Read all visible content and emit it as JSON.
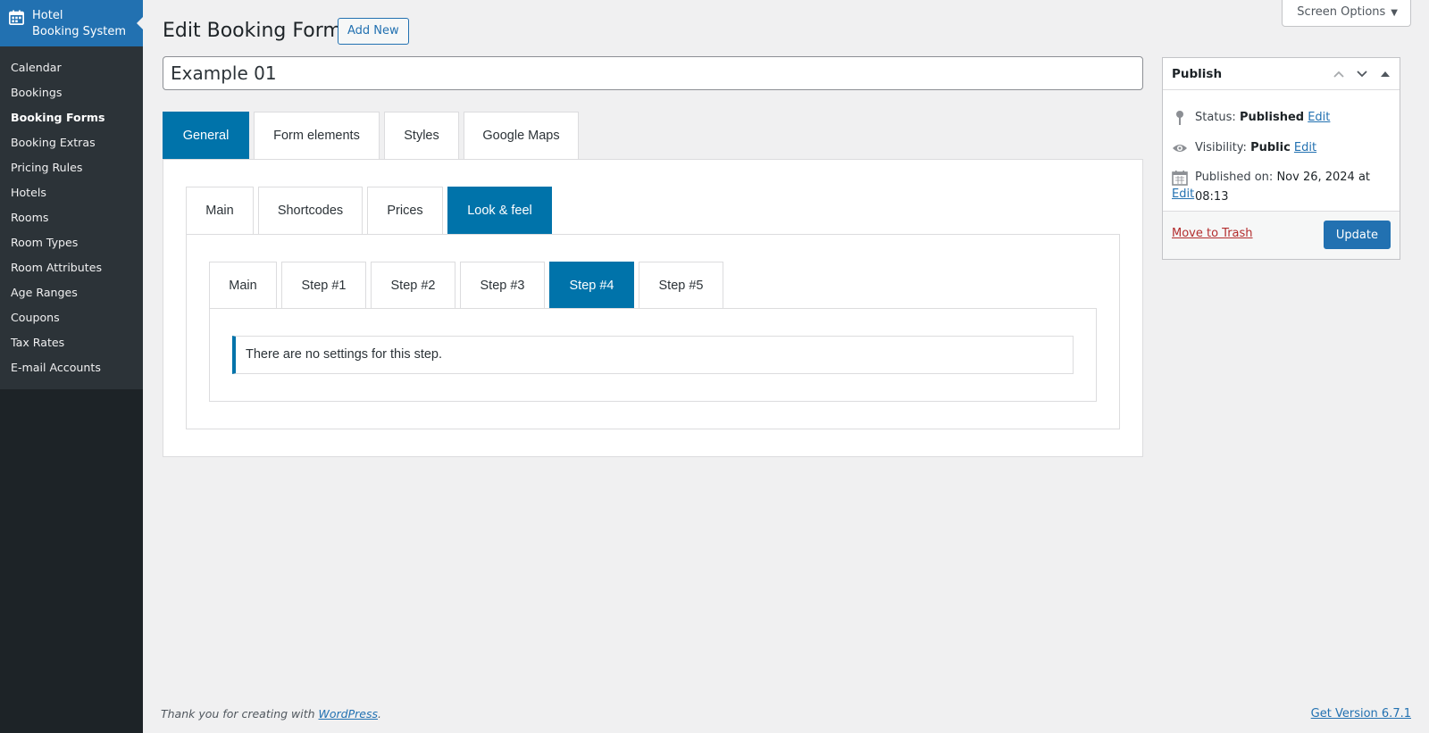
{
  "sidebar": {
    "brand_line1": "Hotel",
    "brand_line2": "Booking System",
    "brand_icon": "calendar-icon",
    "items": [
      {
        "label": "Calendar"
      },
      {
        "label": "Bookings"
      },
      {
        "label": "Booking Forms",
        "current": true
      },
      {
        "label": "Booking Extras"
      },
      {
        "label": "Pricing Rules"
      },
      {
        "label": "Hotels"
      },
      {
        "label": "Rooms"
      },
      {
        "label": "Room Types"
      },
      {
        "label": "Room Attributes"
      },
      {
        "label": "Age Ranges"
      },
      {
        "label": "Coupons"
      },
      {
        "label": "Tax Rates"
      },
      {
        "label": "E-mail Accounts"
      }
    ]
  },
  "header": {
    "title": "Edit Booking Form",
    "add_new_label": "Add New",
    "screen_options_label": "Screen Options"
  },
  "post_title": {
    "value": "Example 01"
  },
  "main_tabs": [
    {
      "label": "General",
      "active": true
    },
    {
      "label": "Form elements"
    },
    {
      "label": "Styles"
    },
    {
      "label": "Google Maps"
    }
  ],
  "sub_tabs": [
    {
      "label": "Main"
    },
    {
      "label": "Shortcodes"
    },
    {
      "label": "Prices"
    },
    {
      "label": "Look & feel",
      "active": true
    }
  ],
  "step_tabs": [
    {
      "label": "Main"
    },
    {
      "label": "Step #1"
    },
    {
      "label": "Step #2"
    },
    {
      "label": "Step #3"
    },
    {
      "label": "Step #4",
      "active": true
    },
    {
      "label": "Step #5"
    }
  ],
  "notice": {
    "text": "There are no settings for this step."
  },
  "publish": {
    "title": "Publish",
    "status_label": "Status:",
    "status_value": "Published",
    "visibility_label": "Visibility:",
    "visibility_value": "Public",
    "published_label": "Published on:",
    "published_value": "Nov 26, 2024 at 08:13",
    "edit_label": "Edit",
    "trash_label": "Move to Trash",
    "update_label": "Update"
  },
  "footer": {
    "thanks_prefix": "Thank you for creating with ",
    "wp_link": "WordPress",
    "thanks_suffix": ".",
    "version": "Get Version 6.7.1"
  },
  "colors": {
    "accent": "#2271b1",
    "tab_active": "#0073aa",
    "sidebar_bg": "#1d2327",
    "trash": "#b32d2e"
  }
}
